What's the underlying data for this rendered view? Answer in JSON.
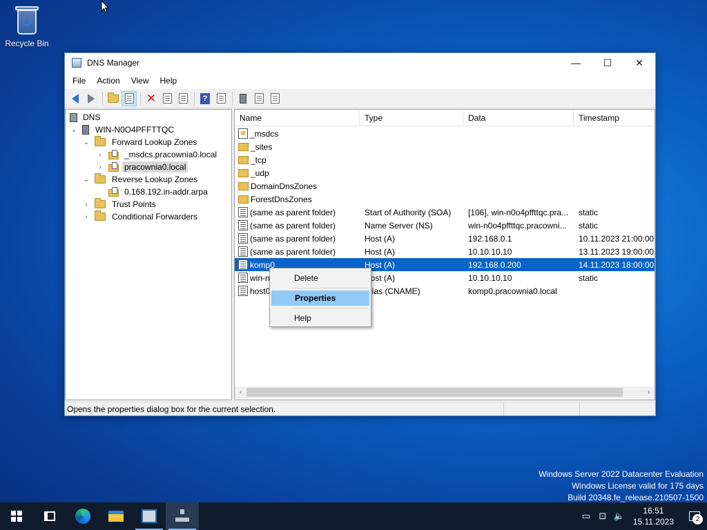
{
  "desktop": {
    "recycle_bin_label": "Recycle Bin"
  },
  "window": {
    "title": "DNS Manager",
    "controls": {
      "minimize": "—",
      "maximize": "☐",
      "close": "✕"
    }
  },
  "menu": [
    "File",
    "Action",
    "View",
    "Help"
  ],
  "tree": {
    "root": "DNS",
    "server": "WIN-N0O4PFFTTQC",
    "forward_lookup": "Forward Lookup Zones",
    "zone_msdcs": "_msdcs.pracownia0.local",
    "zone_main": "pracownia0.local",
    "reverse_lookup": "Reverse Lookup Zones",
    "reverse_zone": "0.168.192.in-addr.arpa",
    "trust_points": "Trust Points",
    "cond_forwarders": "Conditional Forwarders"
  },
  "columns": {
    "name": "Name",
    "type": "Type",
    "data": "Data",
    "timestamp": "Timestamp"
  },
  "records": [
    {
      "icon": "zone",
      "name": "_msdcs",
      "type": "",
      "data": "",
      "timestamp": ""
    },
    {
      "icon": "folder",
      "name": "_sites",
      "type": "",
      "data": "",
      "timestamp": ""
    },
    {
      "icon": "folder",
      "name": "_tcp",
      "type": "",
      "data": "",
      "timestamp": ""
    },
    {
      "icon": "folder",
      "name": "_udp",
      "type": "",
      "data": "",
      "timestamp": ""
    },
    {
      "icon": "folder",
      "name": "DomainDnsZones",
      "type": "",
      "data": "",
      "timestamp": ""
    },
    {
      "icon": "folder",
      "name": "ForestDnsZones",
      "type": "",
      "data": "",
      "timestamp": ""
    },
    {
      "icon": "record",
      "name": "(same as parent folder)",
      "type": "Start of Authority (SOA)",
      "data": "[106], win-n0o4pffttqc.pra...",
      "timestamp": "static"
    },
    {
      "icon": "record",
      "name": "(same as parent folder)",
      "type": "Name Server (NS)",
      "data": "win-n0o4pffttqc.pracowni...",
      "timestamp": "static"
    },
    {
      "icon": "record",
      "name": "(same as parent folder)",
      "type": "Host (A)",
      "data": "192.168.0.1",
      "timestamp": "10.11.2023 21:00:00"
    },
    {
      "icon": "record",
      "name": "(same as parent folder)",
      "type": "Host (A)",
      "data": "10.10.10.10",
      "timestamp": "13.11.2023 19:00:00"
    },
    {
      "icon": "record",
      "name": "komp0",
      "type": "Host (A)",
      "data": "192.168.0.200",
      "timestamp": "14.11.2023 18:00:00",
      "selected": true
    },
    {
      "icon": "record",
      "name": "win-n",
      "type": "Host (A)",
      "data": "10.10.10.10",
      "timestamp": "static"
    },
    {
      "icon": "record",
      "name": "host0",
      "type": "Alias (CNAME)",
      "data": "komp0.pracownia0.local",
      "timestamp": ""
    }
  ],
  "context_menu": {
    "delete": "Delete",
    "properties": "Properties",
    "help": "Help"
  },
  "status_bar": "Opens the properties dialog box for the current selection.",
  "watermark": {
    "line1": "Windows Server 2022 Datacenter Evaluation",
    "line2": "Windows License valid for 175 days",
    "line3": "Build 20348.fe_release.210507-1500"
  },
  "taskbar": {
    "time": "16:51",
    "date": "15.11.2023",
    "notification_count": "2"
  },
  "colors": {
    "selection": "#0a64c8",
    "menu_hover": "#91c9f7",
    "taskbar": "#101c2c"
  }
}
